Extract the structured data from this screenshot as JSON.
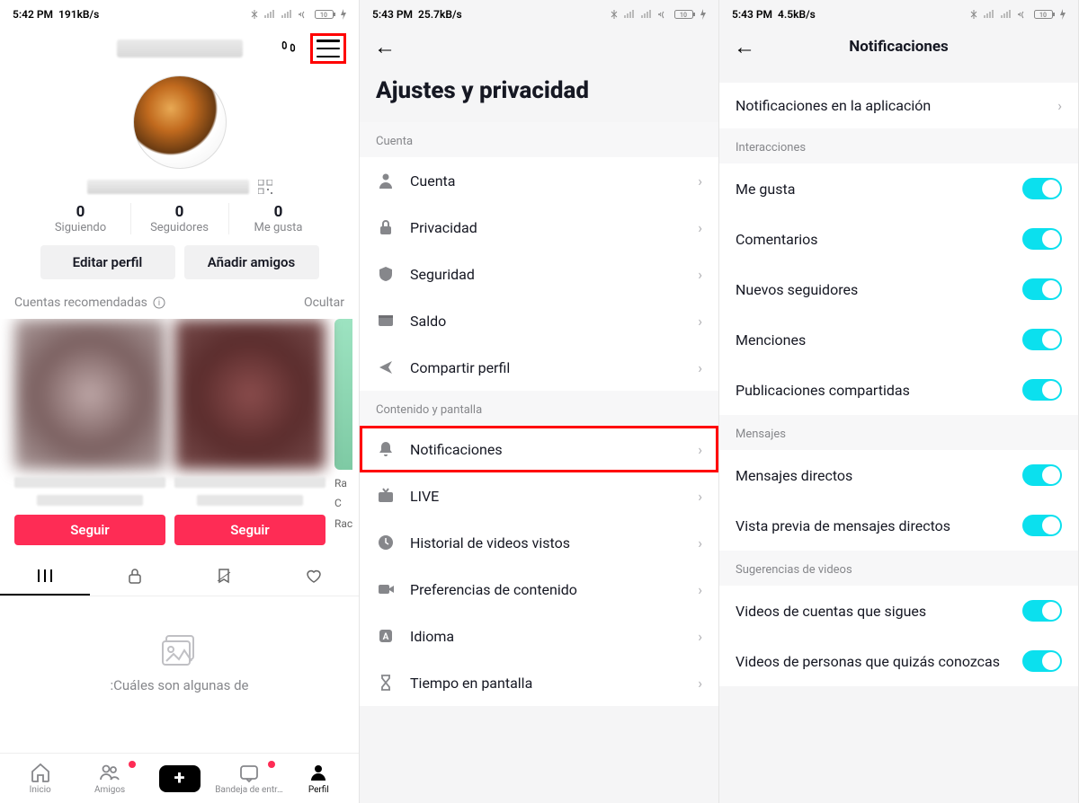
{
  "phone1": {
    "status": {
      "time": "5:42 PM",
      "speed": "191kB/s",
      "battery": "10"
    },
    "stats": {
      "following": {
        "num": "0",
        "label": "Siguiendo"
      },
      "followers": {
        "num": "0",
        "label": "Seguidores"
      },
      "likes": {
        "num": "0",
        "label": "Me gusta"
      }
    },
    "buttons": {
      "edit": "Editar perfil",
      "addFriends": "Añadir amigos"
    },
    "reco": {
      "title": "Cuentas recomendadas",
      "hide": "Ocultar"
    },
    "cards": {
      "follow": "Seguir",
      "peek": {
        "ra": "Ra",
        "c": "C",
        "rac": "Rac"
      }
    },
    "empty": ":Cuáles son algunas de",
    "nav": {
      "home": "Inicio",
      "friends": "Amigos",
      "inbox": "Bandeja de entr…",
      "profile": "Perfil"
    }
  },
  "phone2": {
    "status": {
      "time": "5:43 PM",
      "speed": "25.7kB/s",
      "battery": "10"
    },
    "title": "Ajustes y privacidad",
    "sections": {
      "account": "Cuenta",
      "content": "Contenido y pantalla"
    },
    "rows": {
      "account": "Cuenta",
      "privacy": "Privacidad",
      "security": "Seguridad",
      "balance": "Saldo",
      "share": "Compartir perfil",
      "notifications": "Notificaciones",
      "live": "LIVE",
      "history": "Historial de videos vistos",
      "contentPrefs": "Preferencias de contenido",
      "language": "Idioma",
      "screentime": "Tiempo en pantalla"
    }
  },
  "phone3": {
    "status": {
      "time": "5:43 PM",
      "speed": "4.5kB/s",
      "battery": "10"
    },
    "title": "Notificaciones",
    "rows": {
      "inApp": "Notificaciones en la aplicación"
    },
    "sections": {
      "interactions": "Interacciones",
      "messages": "Mensajes",
      "videoSuggestions": "Sugerencias de videos"
    },
    "toggles": {
      "likes": "Me gusta",
      "comments": "Comentarios",
      "newFollowers": "Nuevos seguidores",
      "mentions": "Menciones",
      "sharedPosts": "Publicaciones compartidas",
      "dms": "Mensajes directos",
      "dmPreview": "Vista previa de mensajes directos",
      "followingVideos": "Videos de cuentas que sigues",
      "suggestedVideos": "Videos de personas que quizás conozcas"
    }
  }
}
